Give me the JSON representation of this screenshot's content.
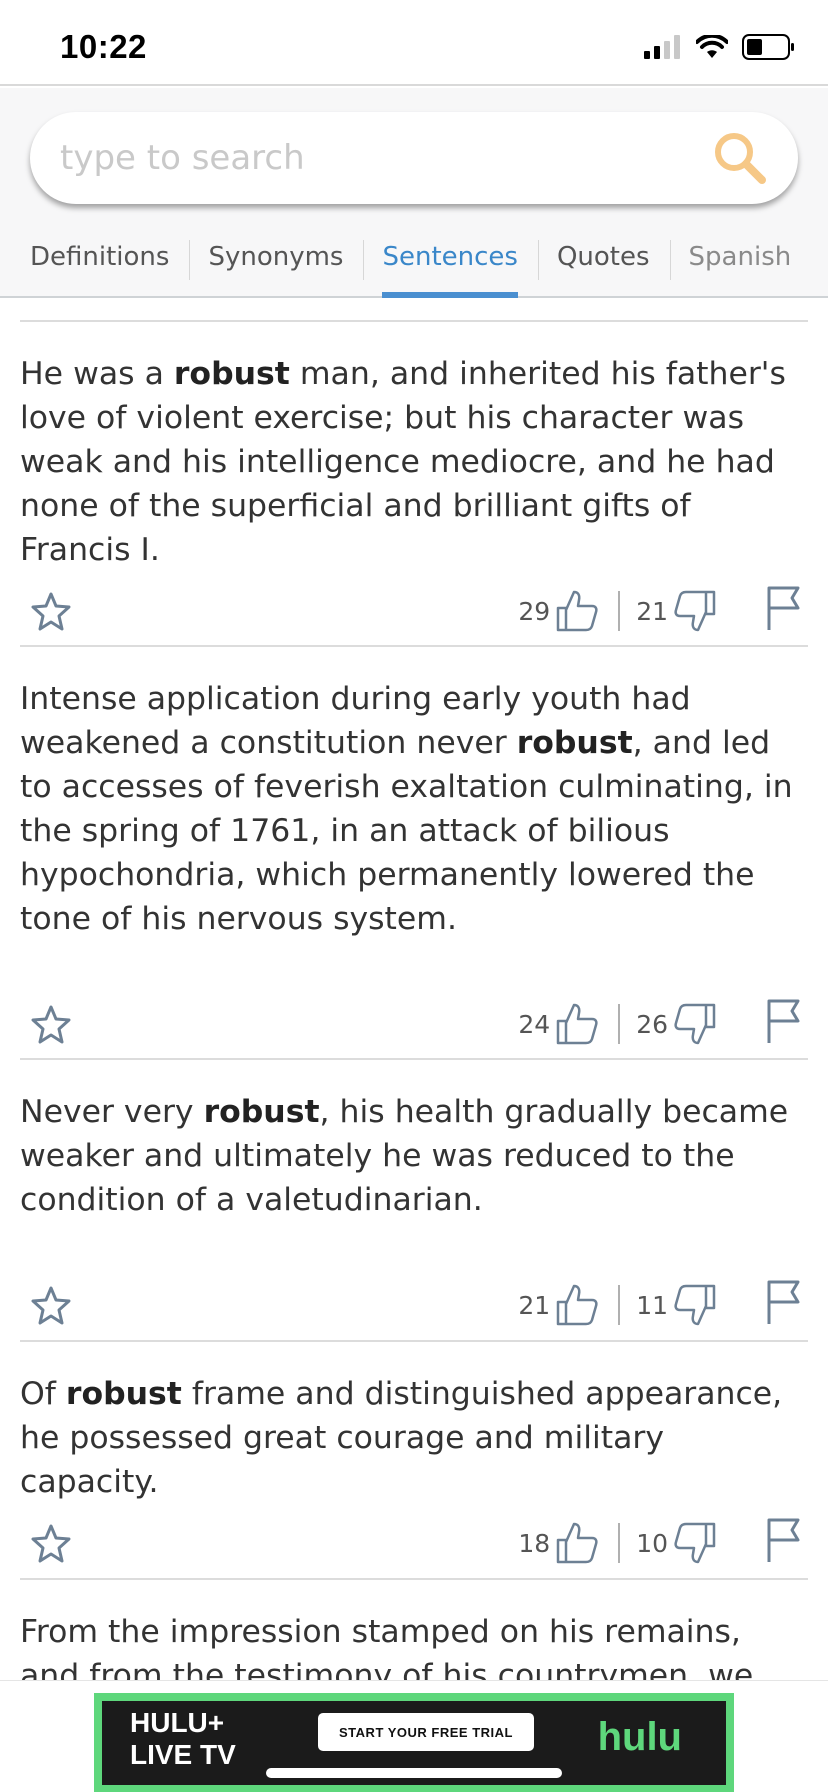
{
  "status_bar": {
    "time": "10:22"
  },
  "search": {
    "placeholder": "type to search"
  },
  "tabs": [
    {
      "label": "Definitions",
      "active": false
    },
    {
      "label": "Synonyms",
      "active": false
    },
    {
      "label": "Sentences",
      "active": true
    },
    {
      "label": "Quotes",
      "active": false
    },
    {
      "label": "Spanish",
      "active": false
    }
  ],
  "sentences": [
    {
      "before": "He was a ",
      "keyword": "robust",
      "after": " man, and inherited his father's love of violent exercise; but his character was weak and his intelligence mediocre, and he had none of the superficial and brilliant gifts of Francis I.",
      "upvotes": "29",
      "downvotes": "21"
    },
    {
      "before": "Intense application during early youth had weakened a constitution never ",
      "keyword": "robust",
      "after": ", and led to accesses of feverish exaltation culminating, in the spring of 1761, in an attack of bilious hypochondria, which permanently lowered the tone of his nervous system.",
      "upvotes": "24",
      "downvotes": "26"
    },
    {
      "before": "Never very ",
      "keyword": "robust",
      "after": ", his health gradually became weaker and ultimately he was reduced to the condition of a valetudinarian.",
      "upvotes": "21",
      "downvotes": "11"
    },
    {
      "before": "Of ",
      "keyword": "robust",
      "after": " frame and distinguished appearance, he possessed great courage and military capacity.",
      "upvotes": "18",
      "downvotes": "10"
    },
    {
      "before": "From the impression stamped on his remains, and from the testimony of his countrymen, we think of",
      "keyword": "",
      "after": ""
    }
  ],
  "ad": {
    "line1": "HULU+",
    "line2": "LIVE TV",
    "cta": "START YOUR FREE TRIAL",
    "brand": "hulu",
    "border_color": "#5ed77c"
  },
  "colors": {
    "accent": "#3a87c9",
    "icon_gray": "#6d8094"
  }
}
